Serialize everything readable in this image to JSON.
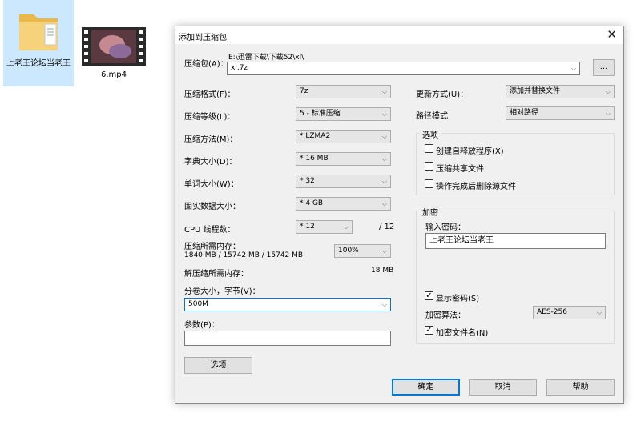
{
  "desktop": {
    "icons": [
      {
        "label": "上老王论坛当老王",
        "type": "folder"
      },
      {
        "label": "6.mp4",
        "type": "video"
      }
    ]
  },
  "dialog": {
    "title": "添加到压缩包",
    "close_glyph": "✕",
    "archive_label": "压缩包(A)：",
    "archive_path": "E:\\迅雷下载\\下载52\\xl\\",
    "archive_name": "xl.7z",
    "browse_label": "...",
    "format_label": "压缩格式(F)：",
    "format_value": "7z",
    "level_label": "压缩等级(L)：",
    "level_value": "5 - 标准压缩",
    "method_label": "压缩方法(M)：",
    "method_value": "* LZMA2",
    "dict_label": "字典大小(D)：",
    "dict_value": "* 16 MB",
    "word_label": "单词大小(W)：",
    "word_value": "* 32",
    "solid_label": "固实数据大小：",
    "solid_value": "* 4 GB",
    "threads_label": "CPU 线程数：",
    "threads_value": "* 12",
    "threads_total": "/ 12",
    "mem_comp_label": "压缩所需内存：",
    "mem_comp_value": "1840 MB / 15742 MB / 15742 MB",
    "mem_percent": "100%",
    "mem_decomp_label": "解压缩所需内存：",
    "mem_decomp_value": "18 MB",
    "split_label": "分卷大小，字节(V)：",
    "split_value": "500M",
    "params_label": "参数(P)：",
    "params_value": "",
    "options_button": "选项",
    "update_label": "更新方式(U)：",
    "update_value": "添加并替换文件",
    "path_label": "路径模式",
    "path_value": "相对路径",
    "options_group_title": "选项",
    "opt_sfx": "创建自释放程序(X)",
    "opt_shared": "压缩共享文件",
    "opt_delete": "操作完成后删除源文件",
    "encrypt_group_title": "加密",
    "password_label": "输入密码：",
    "password_value": "上老王论坛当老王",
    "show_password": "显示密码(S)",
    "enc_method_label": "加密算法：",
    "enc_method_value": "AES-256",
    "encrypt_names": "加密文件名(N)",
    "check_glyph": "✓",
    "ok_button": "确定",
    "cancel_button": "取消",
    "help_button": "帮助",
    "arrow_glyph": "⌵"
  }
}
